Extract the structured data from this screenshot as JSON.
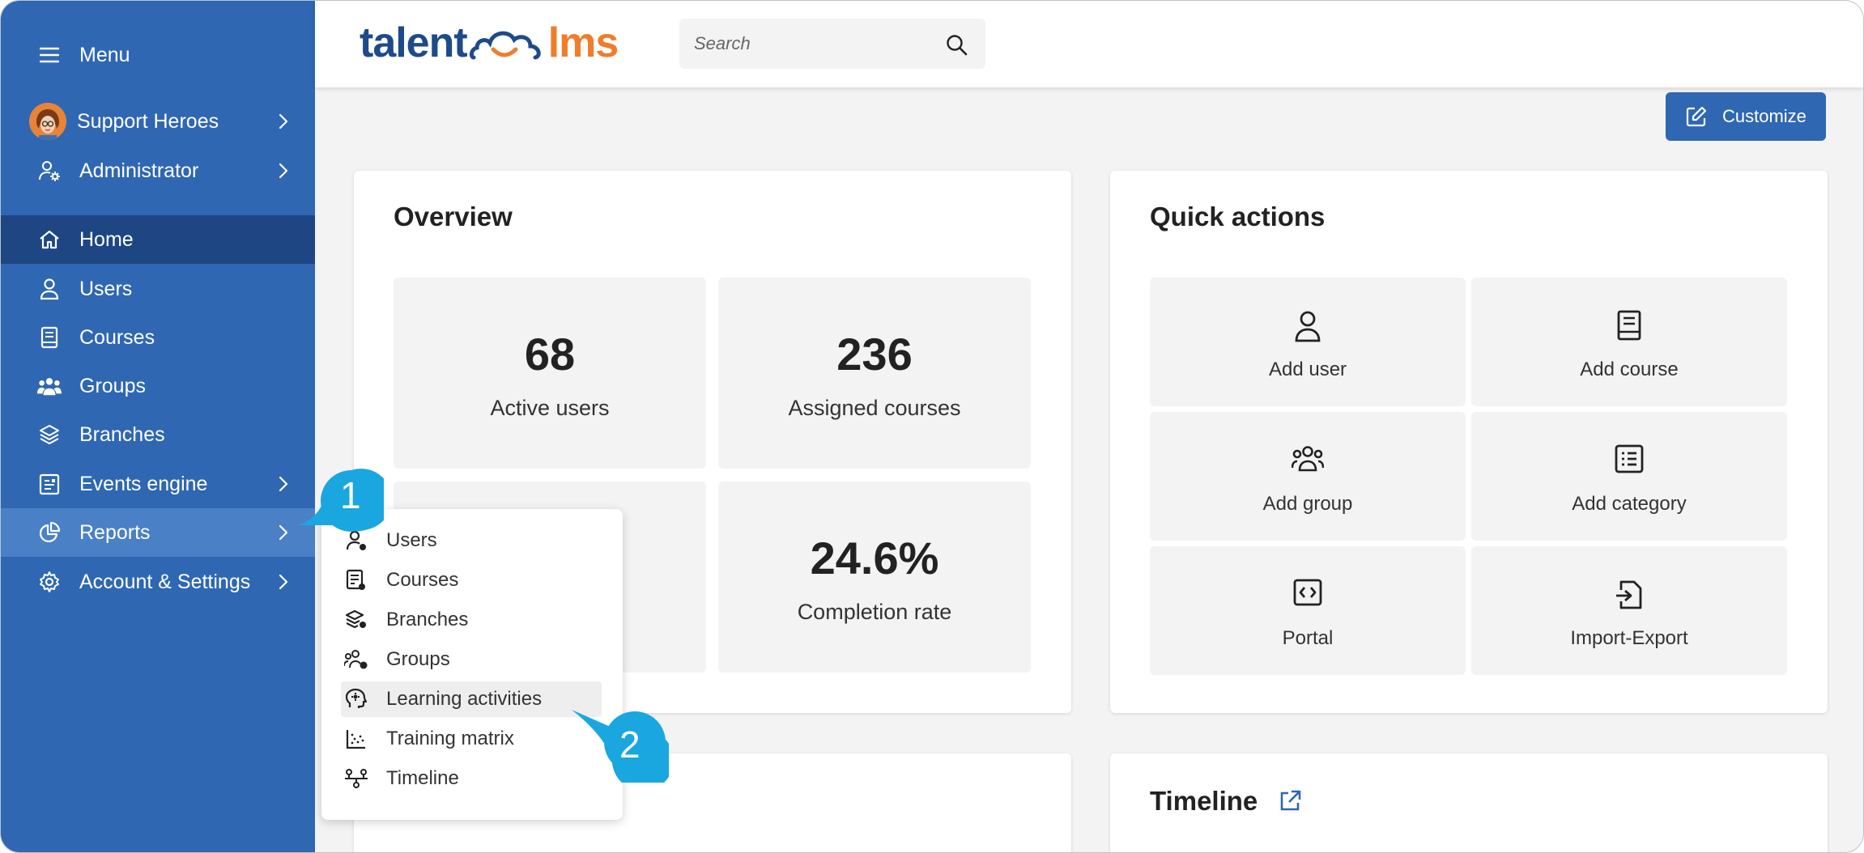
{
  "sidebar": {
    "menu_label": "Menu",
    "portal_label": "Support Heroes",
    "role_label": "Administrator",
    "items": [
      {
        "label": "Home"
      },
      {
        "label": "Users"
      },
      {
        "label": "Courses"
      },
      {
        "label": "Groups"
      },
      {
        "label": "Branches"
      },
      {
        "label": "Events engine"
      },
      {
        "label": "Reports"
      },
      {
        "label": "Account & Settings"
      }
    ]
  },
  "header": {
    "logo_left": "talent",
    "logo_right": "lms",
    "search_placeholder": "Search",
    "customize_label": "Customize"
  },
  "overview": {
    "title": "Overview",
    "stats": [
      {
        "value": "68",
        "label": "Active users"
      },
      {
        "value": "236",
        "label": "Assigned courses"
      },
      {
        "value": "24.6%",
        "label": "Completion rate"
      }
    ]
  },
  "quick_actions": {
    "title": "Quick actions",
    "items": [
      {
        "label": "Add user",
        "icon": "user-icon"
      },
      {
        "label": "Add course",
        "icon": "book-icon"
      },
      {
        "label": "Add group",
        "icon": "group-icon"
      },
      {
        "label": "Add category",
        "icon": "list-icon"
      },
      {
        "label": "Portal",
        "icon": "code-icon"
      },
      {
        "label": "Import-Export",
        "icon": "import-icon"
      }
    ]
  },
  "timeline": {
    "title": "Timeline"
  },
  "reports_menu": {
    "items": [
      {
        "label": "Users"
      },
      {
        "label": "Courses"
      },
      {
        "label": "Branches"
      },
      {
        "label": "Groups"
      },
      {
        "label": "Learning activities"
      },
      {
        "label": "Training matrix"
      },
      {
        "label": "Timeline"
      }
    ]
  },
  "callouts": [
    "1",
    "2"
  ],
  "colors": {
    "sidebar": "#2f67b2",
    "active": "#1e4683",
    "accent": "#1aa7e0",
    "logo_orange": "#ef7d2c"
  }
}
